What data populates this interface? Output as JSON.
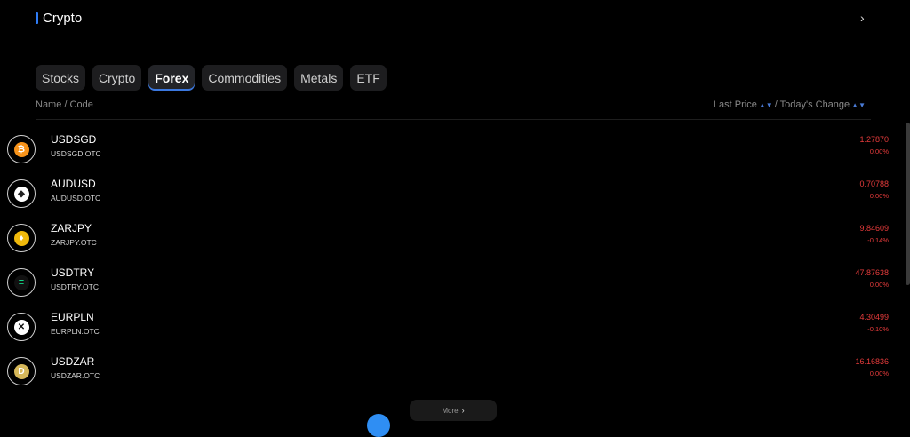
{
  "header": {
    "title": "Crypto"
  },
  "tabs": [
    {
      "label": "Stocks",
      "active": false
    },
    {
      "label": "Crypto",
      "active": false
    },
    {
      "label": "Forex",
      "active": true
    },
    {
      "label": "Commodities",
      "active": false
    },
    {
      "label": "Metals",
      "active": false
    },
    {
      "label": "ETF",
      "active": false
    }
  ],
  "columns": {
    "name": "Name /  Code",
    "last_price": "Last Price",
    "separator": "/",
    "todays_change": "Today's Change"
  },
  "rows": [
    {
      "symbol": "USDSGD",
      "code": "USDSGD.OTC",
      "price": "1.27870",
      "change": "0.00%",
      "icon": "bitcoin-icon"
    },
    {
      "symbol": "AUDUSD",
      "code": "AUDUSD.OTC",
      "price": "0.70788",
      "change": "0.00%",
      "icon": "ethereum-icon"
    },
    {
      "symbol": "ZARJPY",
      "code": "ZARJPY.OTC",
      "price": "9.84609",
      "change": "-0.14%",
      "icon": "binance-coin-icon"
    },
    {
      "symbol": "USDTRY",
      "code": "USDTRY.OTC",
      "price": "47.87638",
      "change": "0.00%",
      "icon": "solana-icon"
    },
    {
      "symbol": "EURPLN",
      "code": "EURPLN.OTC",
      "price": "4.30499",
      "change": "-0.10%",
      "icon": "xrp-icon"
    },
    {
      "symbol": "USDZAR",
      "code": "USDZAR.OTC",
      "price": "16.16836",
      "change": "0.00%",
      "icon": "dogecoin-icon"
    }
  ],
  "more": {
    "label": "More"
  },
  "colors": {
    "accent": "#2f7cf6",
    "negative": "#e53b3b"
  }
}
